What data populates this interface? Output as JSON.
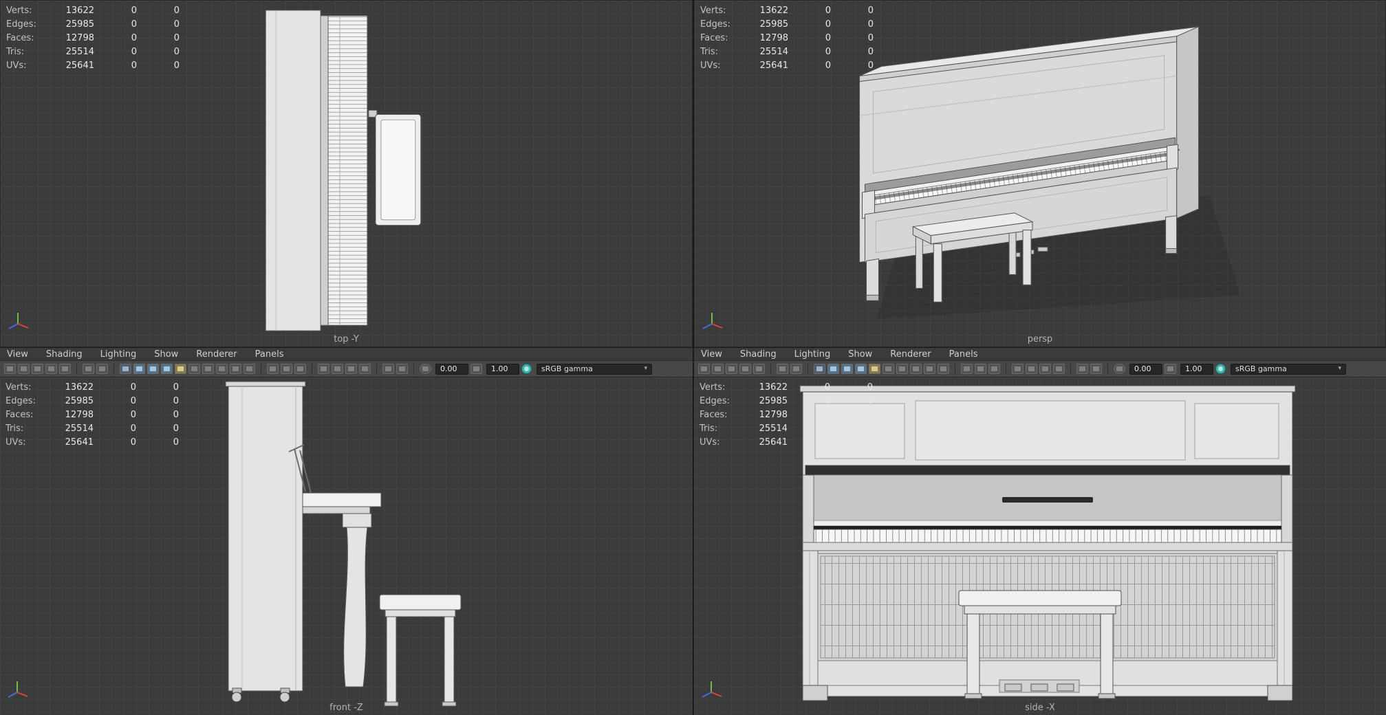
{
  "hud": {
    "rows": [
      {
        "label": "Verts:",
        "v1": "13622",
        "v2": "0",
        "v3": "0"
      },
      {
        "label": "Edges:",
        "v1": "25985",
        "v2": "0",
        "v3": "0"
      },
      {
        "label": "Faces:",
        "v1": "12798",
        "v2": "0",
        "v3": "0"
      },
      {
        "label": "Tris:",
        "v1": "25514",
        "v2": "0",
        "v3": "0"
      },
      {
        "label": "UVs:",
        "v1": "25641",
        "v2": "0",
        "v3": "0"
      }
    ]
  },
  "viewports": {
    "top_left": {
      "label": "top -Y"
    },
    "top_right": {
      "label": "persp"
    },
    "bottom_left": {
      "label": "front -Z"
    },
    "bottom_right": {
      "label": "side -X"
    }
  },
  "panel_menu": {
    "items": [
      "View",
      "Shading",
      "Lighting",
      "Show",
      "Renderer",
      "Panels"
    ]
  },
  "panel_toolbar": {
    "exposure": "0.00",
    "gamma": "1.00",
    "color_space": "sRGB gamma",
    "icon_groups": [
      [
        "panel-menu-icon",
        "camera-select-icon",
        "camera-lock-icon",
        "camera-attributes-icon",
        "bookmark-icon"
      ],
      [
        "image-plane-icon",
        "two-d-pan-zoom-icon"
      ],
      [
        "wireframe-icon",
        "shaded-icon",
        "textured-icon",
        "use-default-material-icon",
        "lighting-icon",
        "shadows-icon",
        "ambient-occlusion-icon",
        "anti-aliasing-icon",
        "depth-of-field-icon",
        "motion-blur-icon"
      ],
      [
        "isolate-select-icon",
        "xray-icon",
        "wireframe-on-shaded-icon"
      ],
      [
        "resolution-gate-icon",
        "film-gate-icon",
        "gate-mask-icon",
        "field-chart-icon"
      ],
      [
        "grease-pencil-icon",
        "snapshot-icon"
      ]
    ]
  },
  "icons": {
    "dropdown_caret": "▾"
  },
  "colors": {
    "viewport_background": "#3b3b3b",
    "grid_line": "#444444",
    "menubar_background": "#3b3b3b",
    "toolbar_background": "#474747",
    "field_background": "#262626",
    "hud_text": "#cccccc",
    "label_text": "#b3b3b3",
    "axis_x": "#d9483b",
    "axis_y": "#6fbf3f",
    "axis_z": "#3f6fd9",
    "color_management_accent": "#35b5ad"
  }
}
